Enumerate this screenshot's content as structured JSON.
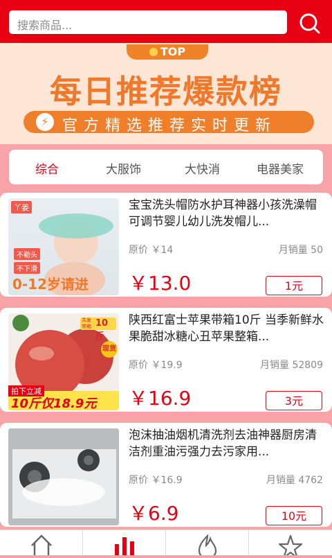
{
  "header": {
    "search_placeholder": "搜索商品..."
  },
  "banner": {
    "badge": "TOP",
    "title": "每日推荐爆款榜",
    "subtitle": "官方精选推荐实时更新"
  },
  "tabs": [
    "综合",
    "大服饰",
    "大快消",
    "电器美家"
  ],
  "products": [
    {
      "title": "宝宝洗头帽防水护耳神器小孩洗澡帽可调节婴儿幼儿洗发帽儿...",
      "orig_price": "原价 ￥14",
      "sales": "月销量 50",
      "price": "￥13.0",
      "coupon": "1元",
      "thumb": {
        "brand": "丫姜",
        "badge1": "不勒头",
        "badge2": "不下滑",
        "caption": "0-12岁请进"
      }
    },
    {
      "title": "陕西红富士苹果带箱10斤 当季新鲜水果脆甜冰糖心丑苹果整箱...",
      "orig_price": "原价 ￥19.9",
      "sales": "月销量 52809",
      "price": "￥16.9",
      "coupon": "3元",
      "thumb": {
        "tag_small": "共发带箱",
        "tag_big": "10斤",
        "badge": "现货",
        "promo_line1": "拍下立减",
        "promo_line2": "10斤仅18.9元"
      }
    },
    {
      "title": "泡沫抽油烟机清洗剂去油神器厨房清洁剂重油污强力去污家用...",
      "orig_price": "原价 ￥16.9",
      "sales": "月销量 4762",
      "price": "￥6.9",
      "coupon": "10元"
    }
  ],
  "icons": {
    "search": "search-icon",
    "bottom": [
      "home-icon",
      "chart-icon",
      "fire-icon",
      "star-icon"
    ]
  },
  "colors": {
    "primary": "#e60012",
    "page_bg": "#f7a3a7",
    "banner_orange": "#f07f2c"
  }
}
